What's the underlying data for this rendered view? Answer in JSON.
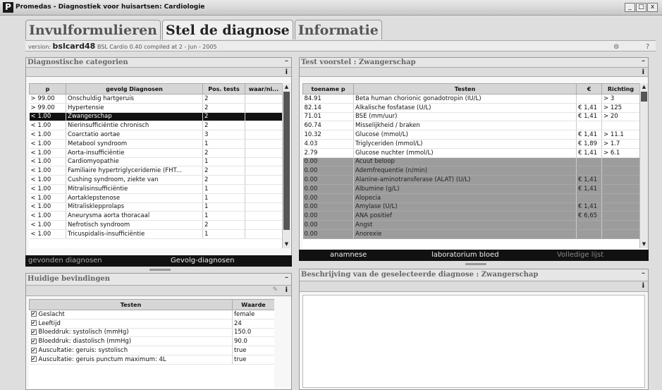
{
  "window": {
    "logo": "P",
    "title": "Promedas - Diagnostiek voor huisartsen: Cardiologie",
    "buttons": [
      "_",
      "□",
      "x"
    ]
  },
  "tabs": [
    {
      "label": "Invulformulieren",
      "active": false
    },
    {
      "label": "Stel de diagnose",
      "active": true
    },
    {
      "label": "Informatie",
      "active": false
    }
  ],
  "version": {
    "label": "version:",
    "value": "bslcard48",
    "detail": "BSL Cardio 0.40 compiled at 2 - Jun - 2005",
    "icon1": "⊚",
    "icon2": "?"
  },
  "diag": {
    "title": "Diagnostische categorien",
    "minimize": "–",
    "info": "i",
    "headers": [
      "p",
      "gevolg Diagnosen",
      "Pos. tests",
      "waar/ni..."
    ],
    "rows": [
      [
        "> 99.00",
        "Onschuldig hartgeruis",
        "2",
        ""
      ],
      [
        "> 99.00",
        "Hypertensie",
        "2",
        ""
      ],
      [
        "< 1.00",
        "Zwangerschap",
        "2",
        ""
      ],
      [
        "< 1.00",
        "Nierinsufficiëntie chronisch",
        "2",
        ""
      ],
      [
        "< 1.00",
        "Coarctatio aortae",
        "3",
        ""
      ],
      [
        "< 1.00",
        "Metabool syndroom",
        "1",
        ""
      ],
      [
        "< 1.00",
        "Aorta-insufficiëntie",
        "2",
        ""
      ],
      [
        "< 1.00",
        "Cardiomyopathie",
        "1",
        ""
      ],
      [
        "< 1.00",
        "Familiaire hypertriglyceridemie (FHT...",
        "2",
        ""
      ],
      [
        "< 1.00",
        "Cushing syndroom, ziekte van",
        "2",
        ""
      ],
      [
        "< 1.00",
        "Mitralisinsufficiëntie",
        "1",
        ""
      ],
      [
        "< 1.00",
        "Aortaklepstenose",
        "1",
        ""
      ],
      [
        "< 1.00",
        "Mitralisklepprolaps",
        "1",
        ""
      ],
      [
        "< 1.00",
        "Aneurysma aorta thoracaal",
        "1",
        ""
      ],
      [
        "< 1.00",
        "Nefrotisch syndroom",
        "2",
        ""
      ],
      [
        "< 1.00",
        "Tricuspidalis-insufficiëntie",
        "1",
        ""
      ]
    ],
    "selected_row": 2,
    "tabs": [
      "gevonden diagnosen",
      "Gevolg-diagnosen"
    ]
  },
  "findings": {
    "title": "Huidige bevindingen",
    "minimize": "–",
    "info": "i",
    "edit_icon": "✎",
    "headers": [
      "Testen",
      "Waarde"
    ],
    "rows": [
      [
        "Geslacht",
        "female"
      ],
      [
        "Leeftijd",
        "24"
      ],
      [
        "Bloeddruk: systolisch (mmHg)",
        "150.0"
      ],
      [
        "Bloeddruk: diastolisch (mmHg)",
        "90.0"
      ],
      [
        "Auscultatie: geruis: systolisch",
        "true"
      ],
      [
        "Auscultatie: geruis punctum maximum: 4L",
        "true"
      ]
    ]
  },
  "tests": {
    "title": "Test voorstel : Zwangerschap",
    "minimize": "–",
    "info": "i",
    "headers": [
      "toename p",
      "Testen",
      "€",
      "Richting"
    ],
    "rows": [
      [
        "84.91",
        "Beta human chorionic gonadotropin (IU/L)",
        "",
        "> 3"
      ],
      [
        "82.14",
        "Alkalische fosfatase (U/L)",
        "€ 1,41",
        "> 125"
      ],
      [
        "71.01",
        "BSE (mm/uur)",
        "€ 1,41",
        "> 20"
      ],
      [
        "60.74",
        "Misselijkheid / braken",
        "",
        ""
      ],
      [
        "10.32",
        "Glucose (mmol/L)",
        "€ 1,41",
        "> 11.1"
      ],
      [
        "4.03",
        "Triglyceriden (mmol/L)",
        "€ 1,89",
        "> 1.7"
      ],
      [
        "2.79",
        "Glucose nuchter (mmol/L)",
        "€ 1,41",
        "> 6.1"
      ],
      [
        "0.00",
        "Acuut beloop",
        "",
        ""
      ],
      [
        "0.00",
        "Ademfrequentie (n/min)",
        "",
        ""
      ],
      [
        "0.00",
        "Alanine-aminotransferase (ALAT) (U/L)",
        "€ 1,41",
        ""
      ],
      [
        "0.00",
        "Albumine (g/L)",
        "€ 1,41",
        ""
      ],
      [
        "0.00",
        "Alopecia",
        "",
        ""
      ],
      [
        "0.00",
        "Amylase (U/L)",
        "€ 1,41",
        ""
      ],
      [
        "0.00",
        "ANA positief",
        "€ 6,65",
        ""
      ],
      [
        "0.00",
        "Angst",
        "",
        ""
      ],
      [
        "0.00",
        "Anorexie",
        "",
        ""
      ]
    ],
    "grey_from": 7,
    "tabs": [
      "anamnese",
      "laboratorium bloed",
      "Volledige lijst"
    ]
  },
  "description": {
    "title": "Beschrijving van de geselecteerde diagnose : Zwangerschap",
    "minimize": "–",
    "info": "i"
  }
}
